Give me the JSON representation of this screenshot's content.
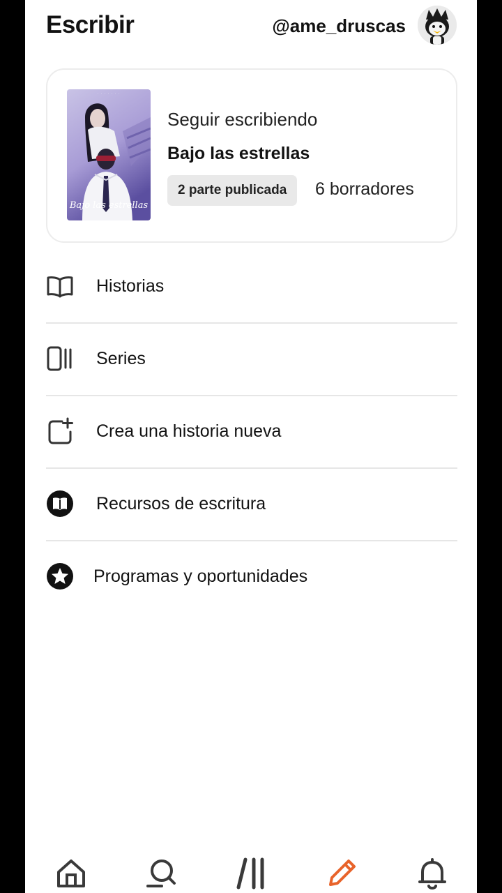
{
  "header": {
    "title": "Escribir",
    "username": "@ame_druscas",
    "avatar_icon": "badtz-maru-avatar"
  },
  "continue_card": {
    "subtitle": "Seguir escribiendo",
    "story_title": "Bajo las estrellas",
    "published_badge": "2 parte publicada",
    "drafts": "6 borradores",
    "cover": {
      "title_text": "Bajo las estrellas",
      "top_text": "· · · · · · ·"
    }
  },
  "menu": [
    {
      "label": "Historias",
      "icon": "open-book-icon"
    },
    {
      "label": "Series",
      "icon": "series-stack-icon"
    },
    {
      "label": "Crea una historia nueva",
      "icon": "new-story-icon"
    },
    {
      "label": "Recursos de escritura",
      "icon": "writing-resources-icon"
    },
    {
      "label": "Programas y oportunidades",
      "icon": "star-badge-icon"
    }
  ],
  "bottom_nav": [
    {
      "name": "home",
      "icon": "home-icon",
      "active": false
    },
    {
      "name": "search",
      "icon": "search-icon",
      "active": false
    },
    {
      "name": "library",
      "icon": "library-icon",
      "active": false
    },
    {
      "name": "write",
      "icon": "pencil-icon",
      "active": true
    },
    {
      "name": "notifications",
      "icon": "bell-icon",
      "active": false
    }
  ],
  "colors": {
    "accent": "#e8632a",
    "text": "#121212",
    "icon": "#333333",
    "divider": "#e6e6e6",
    "pill_bg": "#e9e9e9"
  }
}
